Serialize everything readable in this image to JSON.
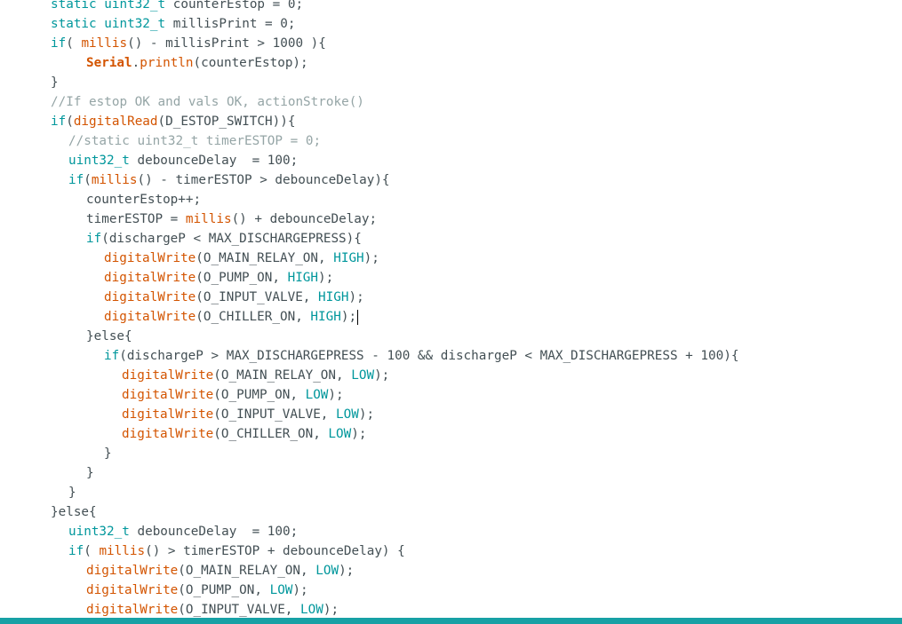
{
  "editor": {
    "lines": [
      {
        "indent": 6,
        "tokens": [
          {
            "t": "static",
            "k": "type"
          },
          {
            "t": " "
          },
          {
            "t": "uint32_t",
            "k": "type"
          },
          {
            "t": " counterEstop = 0;"
          }
        ]
      },
      {
        "indent": 6,
        "tokens": [
          {
            "t": "static",
            "k": "type"
          },
          {
            "t": " "
          },
          {
            "t": "uint32_t",
            "k": "type"
          },
          {
            "t": " millisPrint = 0;"
          }
        ]
      },
      {
        "indent": 6,
        "tokens": [
          {
            "t": "if",
            "k": "type"
          },
          {
            "t": "( "
          },
          {
            "t": "millis",
            "k": "func"
          },
          {
            "t": "() - millisPrint > 1000 ){"
          }
        ]
      },
      {
        "indent": 10,
        "tokens": [
          {
            "t": "Serial",
            "k": "bold"
          },
          {
            "t": "."
          },
          {
            "t": "println",
            "k": "func"
          },
          {
            "t": "(counterEstop);"
          }
        ]
      },
      {
        "indent": 6,
        "tokens": [
          {
            "t": "}"
          }
        ]
      },
      {
        "indent": 6,
        "tokens": [
          {
            "t": "//If estop OK and vals OK, actionStroke()",
            "k": "comment"
          }
        ]
      },
      {
        "indent": 6,
        "tokens": [
          {
            "t": "if",
            "k": "type"
          },
          {
            "t": "("
          },
          {
            "t": "digitalRead",
            "k": "func"
          },
          {
            "t": "(D_ESTOP_SWITCH)){"
          }
        ]
      },
      {
        "indent": 8,
        "tokens": [
          {
            "t": "//static uint32_t timerESTOP = 0;",
            "k": "comment"
          }
        ]
      },
      {
        "indent": 8,
        "tokens": [
          {
            "t": "uint32_t",
            "k": "type"
          },
          {
            "t": " debounceDelay  = 100;"
          }
        ]
      },
      {
        "indent": 8,
        "tokens": [
          {
            "t": "if",
            "k": "type"
          },
          {
            "t": "("
          },
          {
            "t": "millis",
            "k": "func"
          },
          {
            "t": "() - timerESTOP > debounceDelay){"
          }
        ]
      },
      {
        "indent": 10,
        "tokens": [
          {
            "t": "counterEstop++;"
          }
        ]
      },
      {
        "indent": 10,
        "tokens": [
          {
            "t": "timerESTOP = "
          },
          {
            "t": "millis",
            "k": "func"
          },
          {
            "t": "() + debounceDelay;"
          }
        ]
      },
      {
        "indent": 10,
        "tokens": [
          {
            "t": "if",
            "k": "type"
          },
          {
            "t": "(dischargeP < MAX_DISCHARGEPRESS){"
          }
        ]
      },
      {
        "indent": 12,
        "tokens": [
          {
            "t": "digitalWrite",
            "k": "func"
          },
          {
            "t": "(O_MAIN_RELAY_ON, "
          },
          {
            "t": "HIGH",
            "k": "const"
          },
          {
            "t": ");"
          }
        ]
      },
      {
        "indent": 12,
        "tokens": [
          {
            "t": "digitalWrite",
            "k": "func"
          },
          {
            "t": "(O_PUMP_ON, "
          },
          {
            "t": "HIGH",
            "k": "const"
          },
          {
            "t": ");"
          }
        ]
      },
      {
        "indent": 12,
        "tokens": [
          {
            "t": "digitalWrite",
            "k": "func"
          },
          {
            "t": "(O_INPUT_VALVE, "
          },
          {
            "t": "HIGH",
            "k": "const"
          },
          {
            "t": ");"
          }
        ]
      },
      {
        "indent": 12,
        "caret": true,
        "tokens": [
          {
            "t": "digitalWrite",
            "k": "func"
          },
          {
            "t": "(O_CHILLER_ON, "
          },
          {
            "t": "HIGH",
            "k": "const"
          },
          {
            "t": ");"
          }
        ]
      },
      {
        "indent": 10,
        "tokens": [
          {
            "t": "}else{"
          }
        ]
      },
      {
        "indent": 12,
        "tokens": [
          {
            "t": "if",
            "k": "type"
          },
          {
            "t": "(dischargeP > MAX_DISCHARGEPRESS - 100 && dischargeP < MAX_DISCHARGEPRESS + 100){"
          }
        ]
      },
      {
        "indent": 14,
        "tokens": [
          {
            "t": "digitalWrite",
            "k": "func"
          },
          {
            "t": "(O_MAIN_RELAY_ON, "
          },
          {
            "t": "LOW",
            "k": "const"
          },
          {
            "t": ");"
          }
        ]
      },
      {
        "indent": 14,
        "tokens": [
          {
            "t": "digitalWrite",
            "k": "func"
          },
          {
            "t": "(O_PUMP_ON, "
          },
          {
            "t": "LOW",
            "k": "const"
          },
          {
            "t": ");"
          }
        ]
      },
      {
        "indent": 14,
        "tokens": [
          {
            "t": "digitalWrite",
            "k": "func"
          },
          {
            "t": "(O_INPUT_VALVE, "
          },
          {
            "t": "LOW",
            "k": "const"
          },
          {
            "t": ");"
          }
        ]
      },
      {
        "indent": 14,
        "tokens": [
          {
            "t": "digitalWrite",
            "k": "func"
          },
          {
            "t": "(O_CHILLER_ON, "
          },
          {
            "t": "LOW",
            "k": "const"
          },
          {
            "t": ");"
          }
        ]
      },
      {
        "indent": 12,
        "tokens": [
          {
            "t": "}"
          }
        ]
      },
      {
        "indent": 10,
        "tokens": [
          {
            "t": "}"
          }
        ]
      },
      {
        "indent": 8,
        "tokens": [
          {
            "t": "}"
          }
        ]
      },
      {
        "indent": 6,
        "tokens": [
          {
            "t": "}else{"
          }
        ]
      },
      {
        "indent": 8,
        "tokens": [
          {
            "t": "uint32_t",
            "k": "type"
          },
          {
            "t": " debounceDelay  = 100;"
          }
        ]
      },
      {
        "indent": 8,
        "tokens": [
          {
            "t": "if",
            "k": "type"
          },
          {
            "t": "( "
          },
          {
            "t": "millis",
            "k": "func"
          },
          {
            "t": "() > timerESTOP + debounceDelay) {"
          }
        ]
      },
      {
        "indent": 10,
        "tokens": [
          {
            "t": "digitalWrite",
            "k": "func"
          },
          {
            "t": "(O_MAIN_RELAY_ON, "
          },
          {
            "t": "LOW",
            "k": "const"
          },
          {
            "t": ");"
          }
        ]
      },
      {
        "indent": 10,
        "tokens": [
          {
            "t": "digitalWrite",
            "k": "func"
          },
          {
            "t": "(O_PUMP_ON, "
          },
          {
            "t": "LOW",
            "k": "const"
          },
          {
            "t": ");"
          }
        ]
      },
      {
        "indent": 10,
        "tokens": [
          {
            "t": "digitalWrite",
            "k": "func"
          },
          {
            "t": "(O_INPUT_VALVE, "
          },
          {
            "t": "LOW",
            "k": "const"
          },
          {
            "t": ");"
          }
        ]
      }
    ]
  },
  "colors": {
    "keyword": "#00979c",
    "function": "#d35400",
    "comment": "#95a5a6",
    "text": "#434f54",
    "scrollbar": "#17a1a5"
  }
}
